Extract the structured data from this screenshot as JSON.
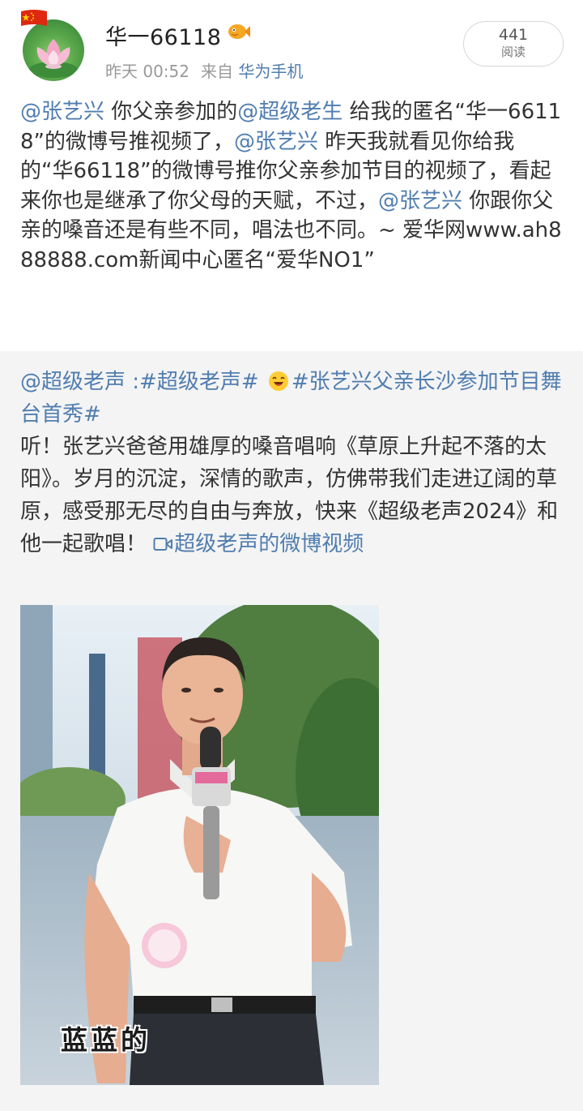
{
  "author": {
    "name": "华一66118",
    "avatar_icon": "lotus-avatar",
    "flag_icon": "china-flag-icon",
    "badge_icon": "fish-badge-icon"
  },
  "meta": {
    "time": "昨天 00:52",
    "source_prefix": "来自",
    "device": "华为手机"
  },
  "reads": {
    "count": "441",
    "label": "阅读"
  },
  "post": {
    "segments": [
      {
        "type": "mention",
        "text": "@张艺兴"
      },
      {
        "type": "text",
        "text": " 你父亲参加的"
      },
      {
        "type": "mention",
        "text": "@超级老生"
      },
      {
        "type": "text",
        "text": " 给我的匿名“华一66118”的微博号推视频了，"
      },
      {
        "type": "mention",
        "text": "@张艺兴"
      },
      {
        "type": "text",
        "text": " 昨天我就看见你给我的“华66118”的微博号推你父亲参加节目的视频了，看起来你也是继承了你父母的天赋，不过，"
      },
      {
        "type": "mention",
        "text": "@张艺兴"
      },
      {
        "type": "text",
        "text": " 你跟你父亲的嗓音还是有些不同，唱法也不同。~ 爱华网www.ah888888.com新闻中心匿名“爱华NO1”"
      }
    ]
  },
  "repost": {
    "author": "@超级老声",
    "sep": " :",
    "topic1": "#超级老声#",
    "emoji_icon": "laughing-emoji-icon",
    "topic2": "#张艺兴父亲长沙参加节目舞台首秀#",
    "body": "听！张艺兴爸爸用雄厚的嗓音唱响《草原上升起不落的太阳》。岁月的沉淀，深情的歌声，仿佛带我们走进辽阔的草原，感受那无尽的自由与奔放，快来《超级老声2024》和他一起歌唱！",
    "video_link": "超级老声的微博视频",
    "video_icon": "video-link-icon",
    "image_caption": "蓝蓝的"
  },
  "colors": {
    "link": "#507daf",
    "text": "#333333",
    "meta": "#999999",
    "repost_bg": "#f4f4f4"
  }
}
